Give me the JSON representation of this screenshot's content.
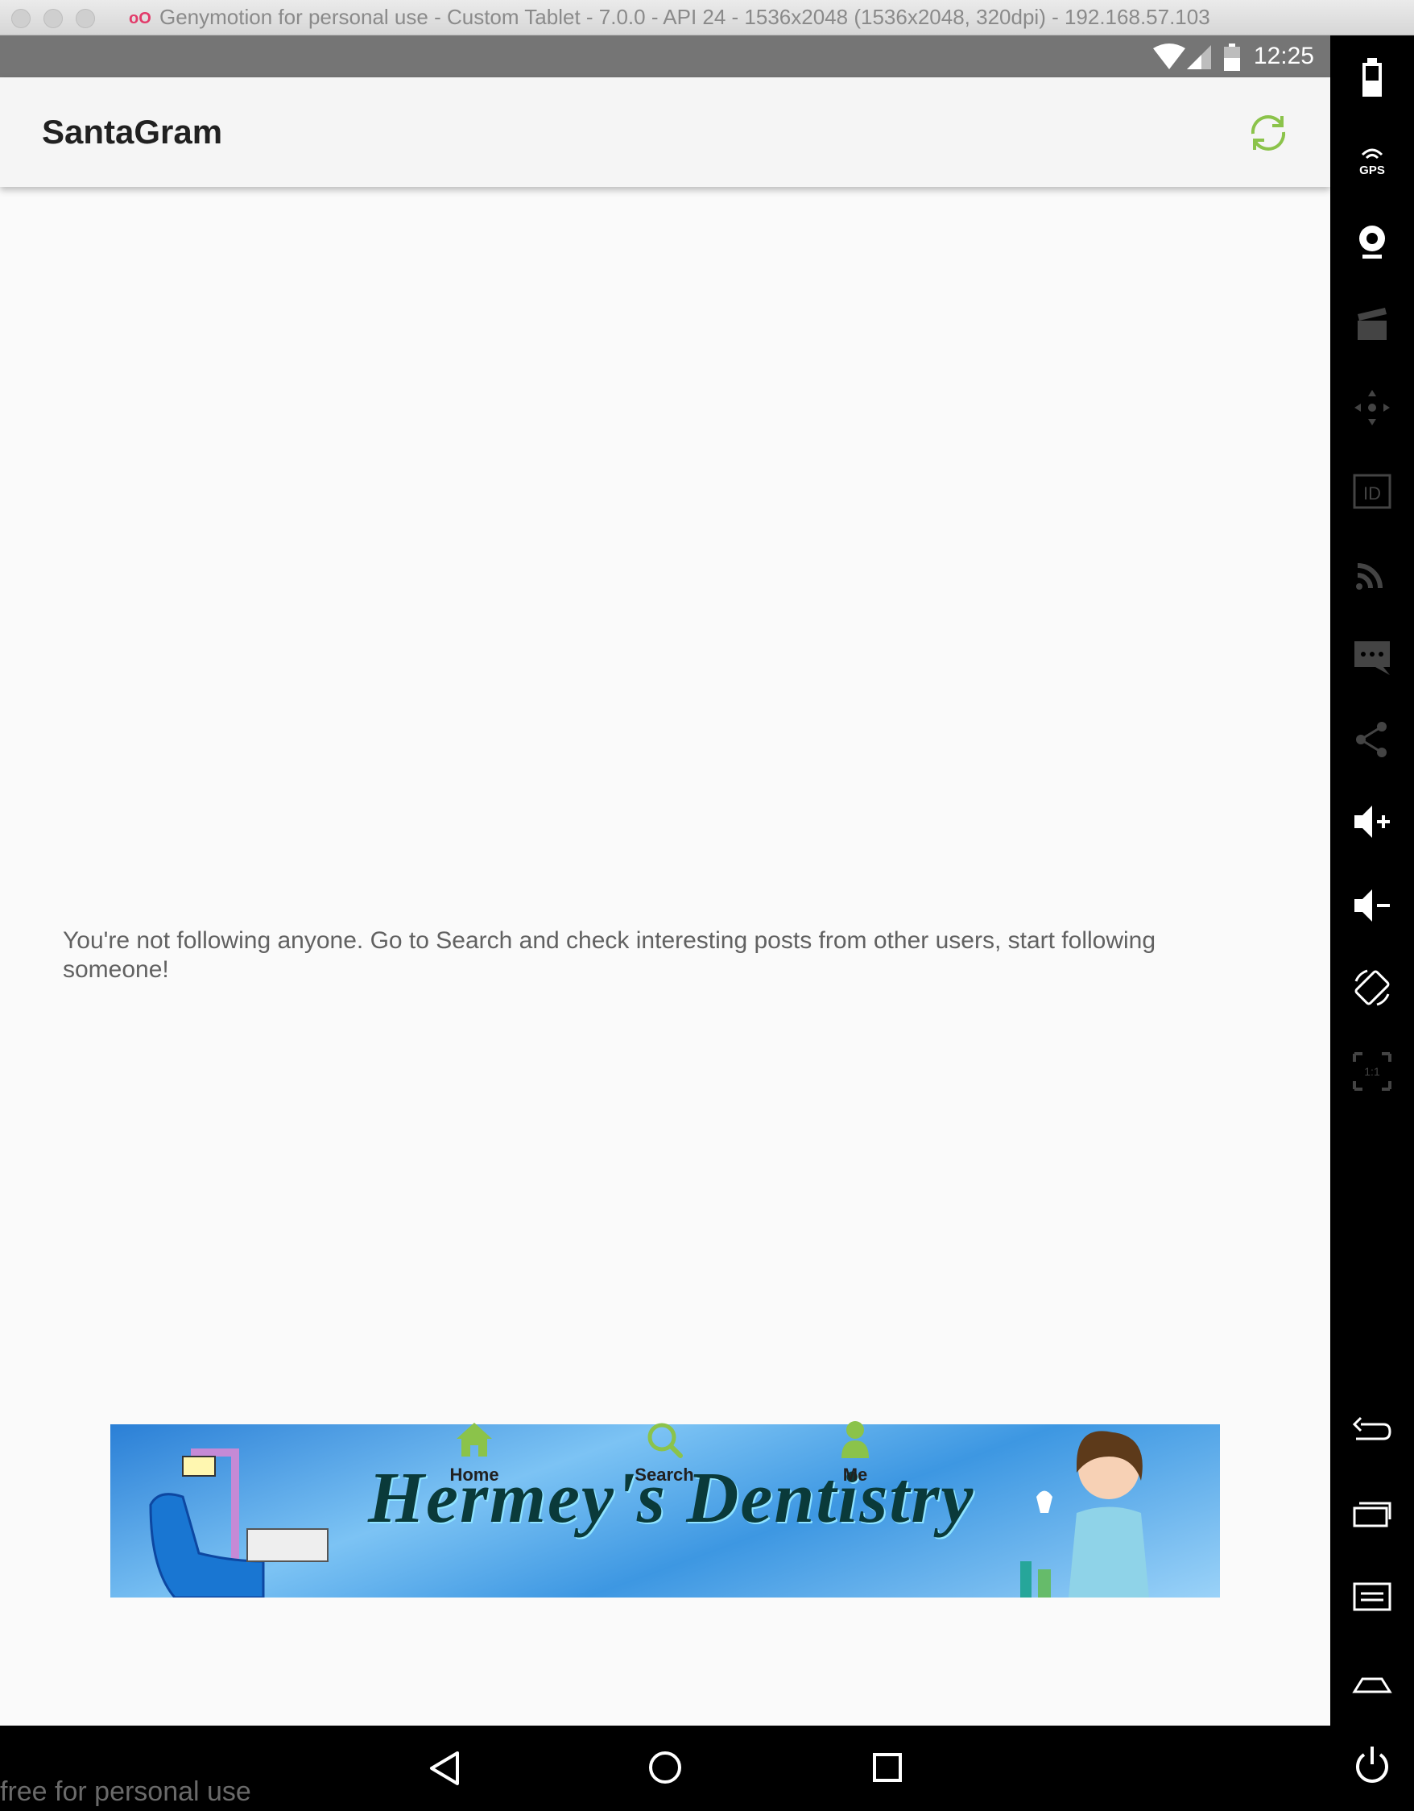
{
  "window": {
    "title": "Genymotion for personal use - Custom Tablet - 7.0.0 - API 24 - 1536x2048 (1536x2048, 320dpi) - 192.168.57.103",
    "logo": "oO"
  },
  "statusbar": {
    "time": "12:25"
  },
  "appbar": {
    "title": "SantaGram",
    "refresh_icon": "refresh-icon"
  },
  "main": {
    "empty_message": "You're not following anyone. Go to Search and check interesting posts from other users, start following someone!"
  },
  "banner": {
    "text": "Hermey's Dentistry"
  },
  "bottom_nav": {
    "items": [
      {
        "label": "Home",
        "icon": "home-icon"
      },
      {
        "label": "Search",
        "icon": "search-icon"
      },
      {
        "label": "Me",
        "icon": "person-icon"
      }
    ]
  },
  "watermark": "free for personal use",
  "colors": {
    "accent": "#8bc34a",
    "statusbar": "#757575",
    "appbar": "#f5f5f5"
  },
  "side_panel": {
    "icons": [
      "battery-icon",
      "gps-icon",
      "webcam-icon",
      "capture-icon",
      "remote-control-icon",
      "id-icon",
      "disk-io-icon",
      "sms-icon",
      "share-icon",
      "volume-up-icon",
      "volume-down-icon",
      "rotate-icon",
      "pixel-perfect-icon",
      "back-icon",
      "recent-apps-icon",
      "menu-icon",
      "home-icon",
      "power-icon"
    ],
    "gps_label": "GPS",
    "id_label": "ID",
    "scale_label": "1:1"
  }
}
